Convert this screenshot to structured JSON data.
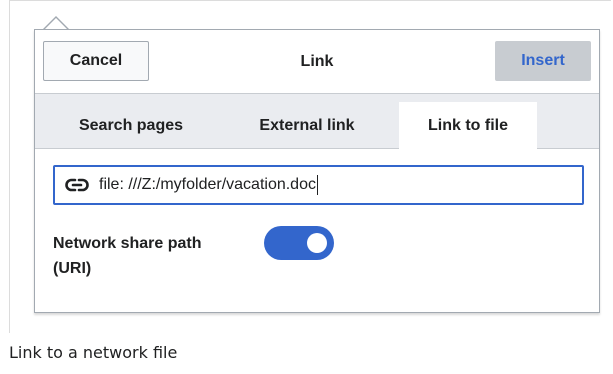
{
  "dialog": {
    "title": "Link",
    "cancel_label": "Cancel",
    "insert_label": "Insert"
  },
  "tabs": [
    {
      "label": "Search pages",
      "selected": false
    },
    {
      "label": "External link",
      "selected": false
    },
    {
      "label": "Link to file",
      "selected": true
    }
  ],
  "link_input": {
    "value": "file: ///Z:/myfolder/vacation.doc",
    "icon": "link-icon"
  },
  "toggle": {
    "label": "Network share path (URI)",
    "on": true
  },
  "caption": "Link to a network file",
  "colors": {
    "accent": "#3366cc",
    "insert_bg": "#c8ccd1",
    "tabbar_bg": "#eaecf0"
  }
}
